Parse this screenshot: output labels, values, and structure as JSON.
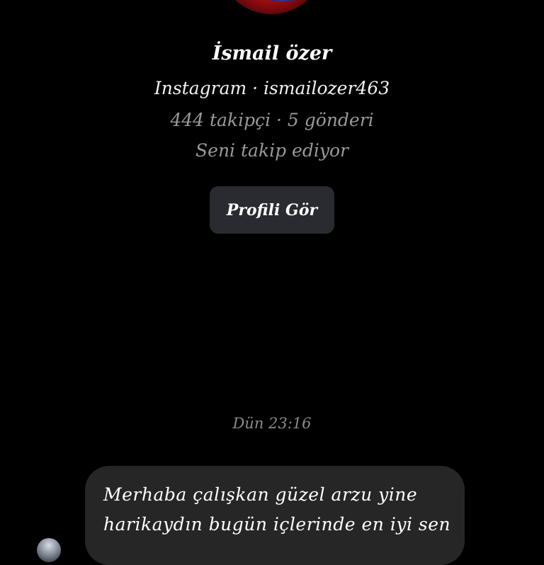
{
  "profile": {
    "name": "İsmail özer",
    "handle_line": "Instagram · ismailozer463",
    "stats_line": "444 takipçi · 5 gönderi",
    "follow_status": "Seni takip ediyor",
    "view_profile_label": "Profili Gör"
  },
  "conversation": {
    "timestamp": "Dün 23:16",
    "messages": [
      {
        "lines": [
          "Merhaba çalışkan güzel arzu yine",
          "harikaydın bugün içlerinde en iyi sen"
        ]
      }
    ]
  },
  "colors": {
    "background": "#000000",
    "button_bg": "#2a2b30",
    "bubble_bg": "#262626",
    "muted_text": "#9a9a9a"
  }
}
